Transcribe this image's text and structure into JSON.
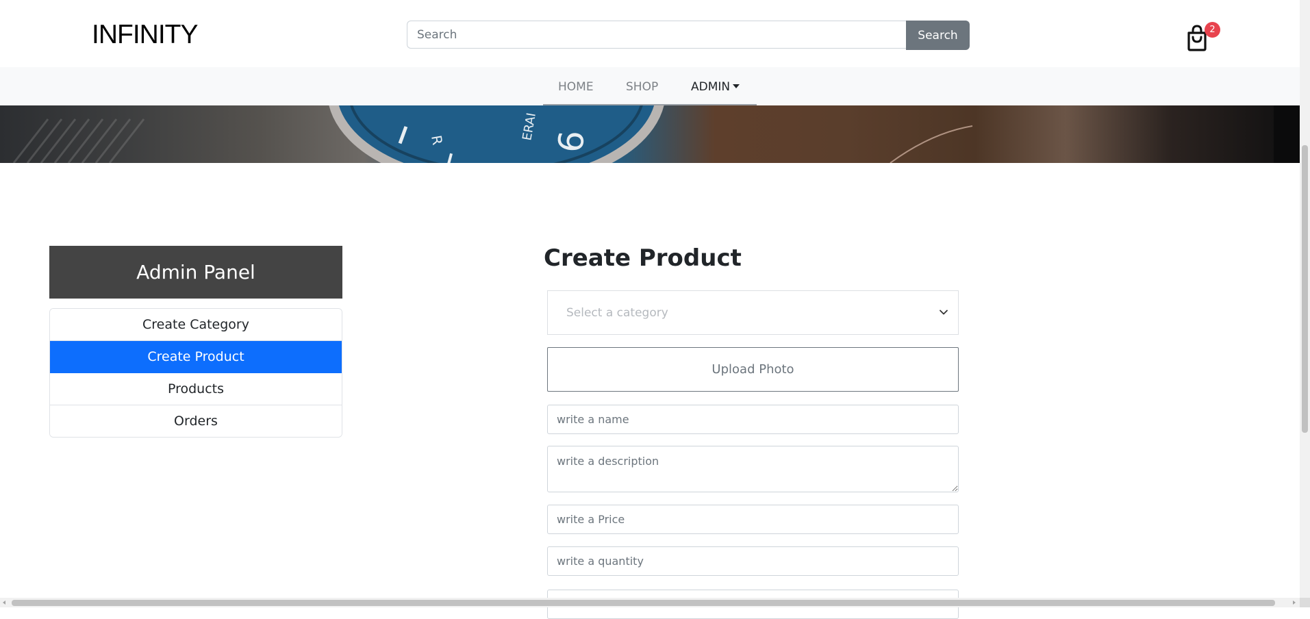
{
  "header": {
    "brand": "INFINITY",
    "search_placeholder": "Search",
    "search_button": "Search",
    "cart_count": "2"
  },
  "nav": {
    "home": "HOME",
    "shop": "SHOP",
    "admin": "ADMIN"
  },
  "sidebar": {
    "title": "Admin Panel",
    "items": [
      {
        "label": "Create Category",
        "active": false
      },
      {
        "label": "Create Product",
        "active": true
      },
      {
        "label": "Products",
        "active": false
      },
      {
        "label": "Orders",
        "active": false
      }
    ]
  },
  "form": {
    "title": "Create Product",
    "category_placeholder": "Select a category",
    "upload_label": "Upload Photo",
    "name_placeholder": "write a name",
    "description_placeholder": "write a description",
    "price_placeholder": "write a Price",
    "quantity_placeholder": "write a quantity"
  },
  "colors": {
    "accent": "#0d6efd",
    "panel_header": "#444444",
    "search_button": "#6c757d",
    "badge": "#e8434e"
  }
}
